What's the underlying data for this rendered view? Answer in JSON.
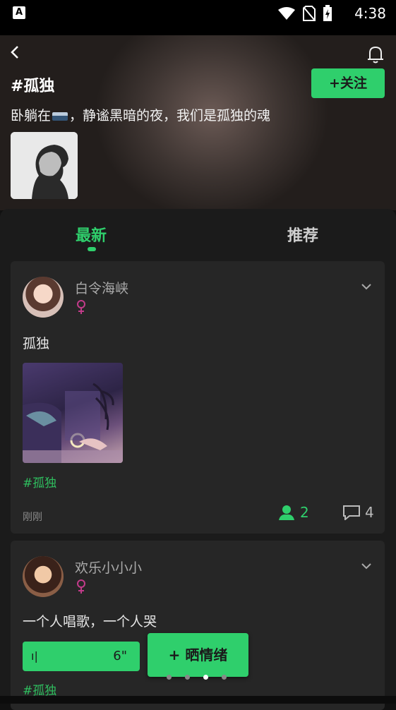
{
  "status_bar": {
    "time": "4:38",
    "icons": [
      "a-app-icon",
      "wifi-icon",
      "no-sim-icon",
      "battery-charging-icon"
    ]
  },
  "header": {
    "title": "#孤独",
    "follow_label": "+关注",
    "description_before": "卧躺在",
    "description_after": "，静谧黑暗的夜，我们是孤独的魂"
  },
  "tabs": [
    {
      "label": "最新",
      "active": true
    },
    {
      "label": "推荐",
      "active": false
    }
  ],
  "posts": [
    {
      "username": "白令海峡",
      "gender": "female",
      "text": "孤独",
      "tag": "#孤独",
      "time": "刚刚",
      "likes": "2",
      "comments": "4"
    },
    {
      "username": "欢乐小小小",
      "gender": "female",
      "text": "一个人唱歌，一个人哭",
      "voice_duration": "6\"",
      "tag": "#孤独"
    }
  ],
  "fab": {
    "label": "+ 晒情绪"
  },
  "pager": {
    "count": 4,
    "active_index": 2
  },
  "colors": {
    "accent": "#2fcf6c",
    "female": "#c23b8a",
    "card": "#262626",
    "background": "#1b1b1b"
  }
}
